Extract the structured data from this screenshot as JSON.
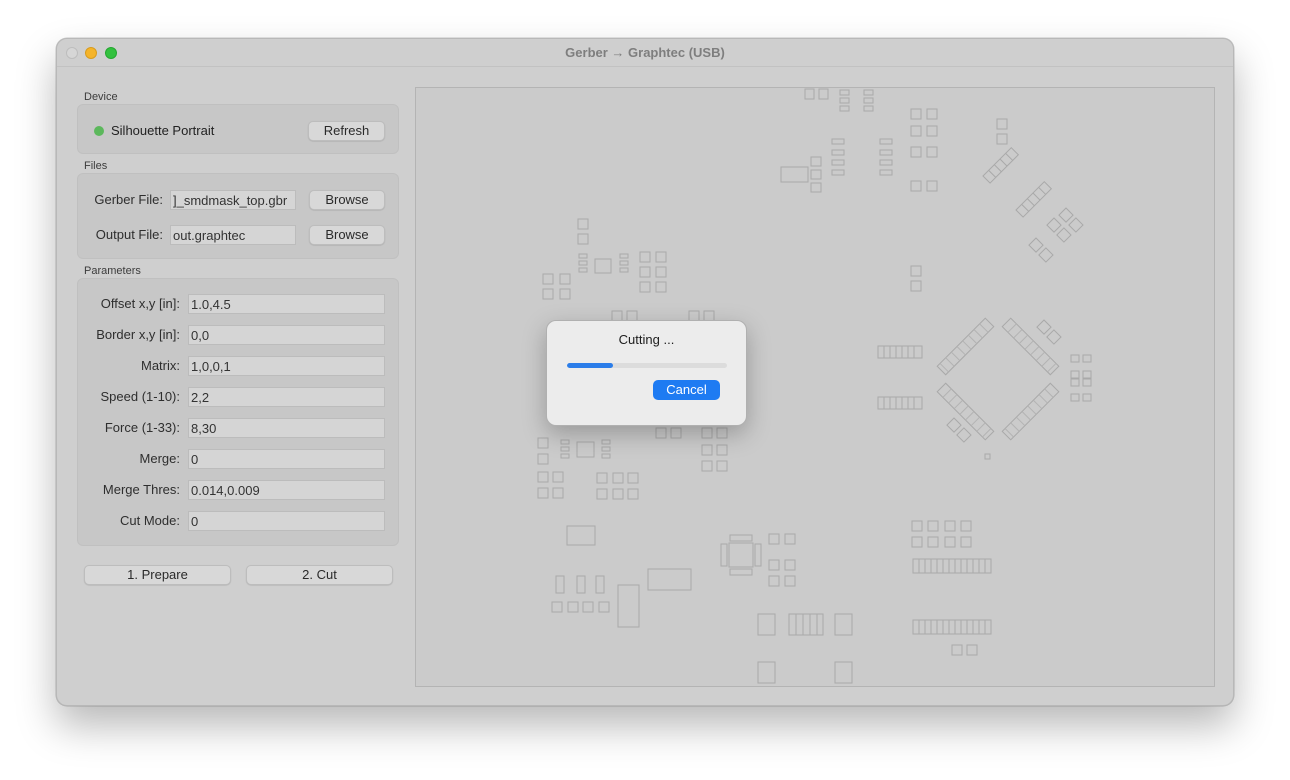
{
  "window": {
    "title": "Gerber → Graphtec (USB)"
  },
  "device": {
    "section_label": "Device",
    "name": "Silhouette Portrait",
    "status_color": "#5cb85c",
    "refresh_label": "Refresh"
  },
  "files": {
    "section_label": "Files",
    "gerber_label": "Gerber File:",
    "gerber_value": "]_smdmask_top.gbr",
    "output_label": "Output File:",
    "output_value": "out.graphtec",
    "browse_label": "Browse"
  },
  "parameters": {
    "section_label": "Parameters",
    "rows": [
      {
        "label": "Offset x,y [in]:",
        "value": "1.0,4.5"
      },
      {
        "label": "Border x,y [in]:",
        "value": "0,0"
      },
      {
        "label": "Matrix:",
        "value": "1,0,0,1"
      },
      {
        "label": "Speed (1-10):",
        "value": "2,2"
      },
      {
        "label": "Force (1-33):",
        "value": "8,30"
      },
      {
        "label": "Merge:",
        "value": "0"
      },
      {
        "label": "Merge Thres:",
        "value": "0.014,0.009"
      },
      {
        "label": "Cut Mode:",
        "value": "0"
      }
    ]
  },
  "actions": {
    "prepare_label": "1. Prepare",
    "cut_label": "2. Cut"
  },
  "dialog": {
    "title": "Cutting ...",
    "progress": 0.29,
    "cancel_label": "Cancel",
    "accent_color": "#1e7bf2"
  }
}
